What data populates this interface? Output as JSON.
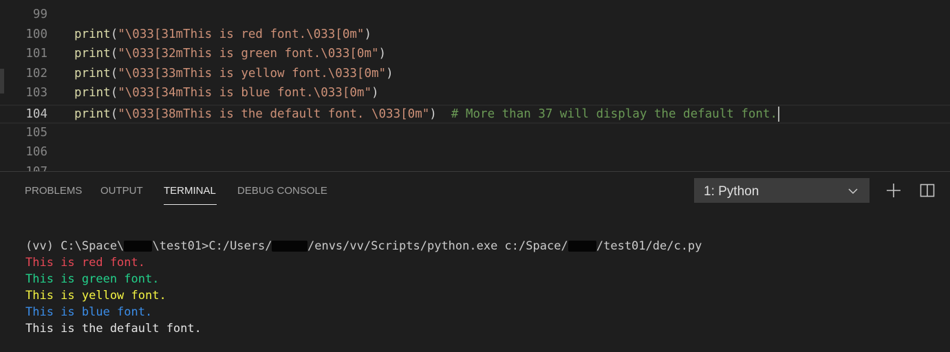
{
  "editor": {
    "lines": [
      {
        "num": "99",
        "parts": []
      },
      {
        "num": "100",
        "parts": [
          {
            "cls": "fn",
            "text": "print"
          },
          {
            "cls": "pn",
            "text": "("
          },
          {
            "cls": "st",
            "text": "\"\\033[31mThis is red font.\\033[0m\""
          },
          {
            "cls": "pn",
            "text": ")"
          }
        ]
      },
      {
        "num": "101",
        "parts": [
          {
            "cls": "fn",
            "text": "print"
          },
          {
            "cls": "pn",
            "text": "("
          },
          {
            "cls": "st",
            "text": "\"\\033[32mThis is green font.\\033[0m\""
          },
          {
            "cls": "pn",
            "text": ")"
          }
        ]
      },
      {
        "num": "102",
        "parts": [
          {
            "cls": "fn",
            "text": "print"
          },
          {
            "cls": "pn",
            "text": "("
          },
          {
            "cls": "st",
            "text": "\"\\033[33mThis is yellow font.\\033[0m\""
          },
          {
            "cls": "pn",
            "text": ")"
          }
        ]
      },
      {
        "num": "103",
        "parts": [
          {
            "cls": "fn",
            "text": "print"
          },
          {
            "cls": "pn",
            "text": "("
          },
          {
            "cls": "st",
            "text": "\"\\033[34mThis is blue font.\\033[0m\""
          },
          {
            "cls": "pn",
            "text": ")"
          }
        ]
      },
      {
        "num": "104",
        "current": true,
        "parts": [
          {
            "cls": "fn",
            "text": "print"
          },
          {
            "cls": "pn",
            "text": "("
          },
          {
            "cls": "st",
            "text": "\"\\033[38mThis is the default font. \\033[0m\""
          },
          {
            "cls": "pn",
            "text": ")  "
          },
          {
            "cls": "cm",
            "text": "# More than 37 will display the default font."
          }
        ]
      },
      {
        "num": "105",
        "parts": []
      },
      {
        "num": "106",
        "parts": []
      },
      {
        "num": "107",
        "parts": []
      }
    ]
  },
  "panel": {
    "tabs": [
      {
        "label": "PROBLEMS",
        "active": false
      },
      {
        "label": "OUTPUT",
        "active": false
      },
      {
        "label": "TERMINAL",
        "active": true
      },
      {
        "label": "DEBUG CONSOLE",
        "active": false
      }
    ],
    "terminal_select": {
      "value": "1: Python",
      "icon": "chevron-down-icon"
    },
    "actions": [
      {
        "name": "new-terminal-button",
        "icon": "plus-icon"
      },
      {
        "name": "split-terminal-button",
        "icon": "split-icon"
      }
    ]
  },
  "terminal": {
    "lines": [
      {
        "color": "#cccccc",
        "parts": [
          {
            "text": "(vv) C:\\Space\\"
          },
          {
            "redacted": true,
            "chars": 4
          },
          {
            "text": "\\test01>C:/Users/"
          },
          {
            "redacted": true,
            "chars": 5
          },
          {
            "text": "/envs/vv/Scripts/python.exe c:/Space/"
          },
          {
            "redacted": true,
            "chars": 4
          },
          {
            "text": "/test01/de/c.py"
          }
        ]
      },
      {
        "color": "#e74856",
        "parts": [
          {
            "text": "This is red font."
          }
        ]
      },
      {
        "color": "#23d18b",
        "parts": [
          {
            "text": "This is green font."
          }
        ]
      },
      {
        "color": "#f5f543",
        "parts": [
          {
            "text": "This is yellow font."
          }
        ]
      },
      {
        "color": "#3b8eea",
        "parts": [
          {
            "text": "This is blue font."
          }
        ]
      },
      {
        "color": "#e5e5e5",
        "parts": [
          {
            "text": "This is the default font."
          }
        ]
      }
    ]
  },
  "colors": {
    "background": "#1e1e1e",
    "function": "#dcdcaa",
    "string": "#ce9178",
    "comment": "#6a9955",
    "line_number": "#858585",
    "active_tab": "#e7e7e7",
    "inactive_tab": "#a0a0a0"
  }
}
